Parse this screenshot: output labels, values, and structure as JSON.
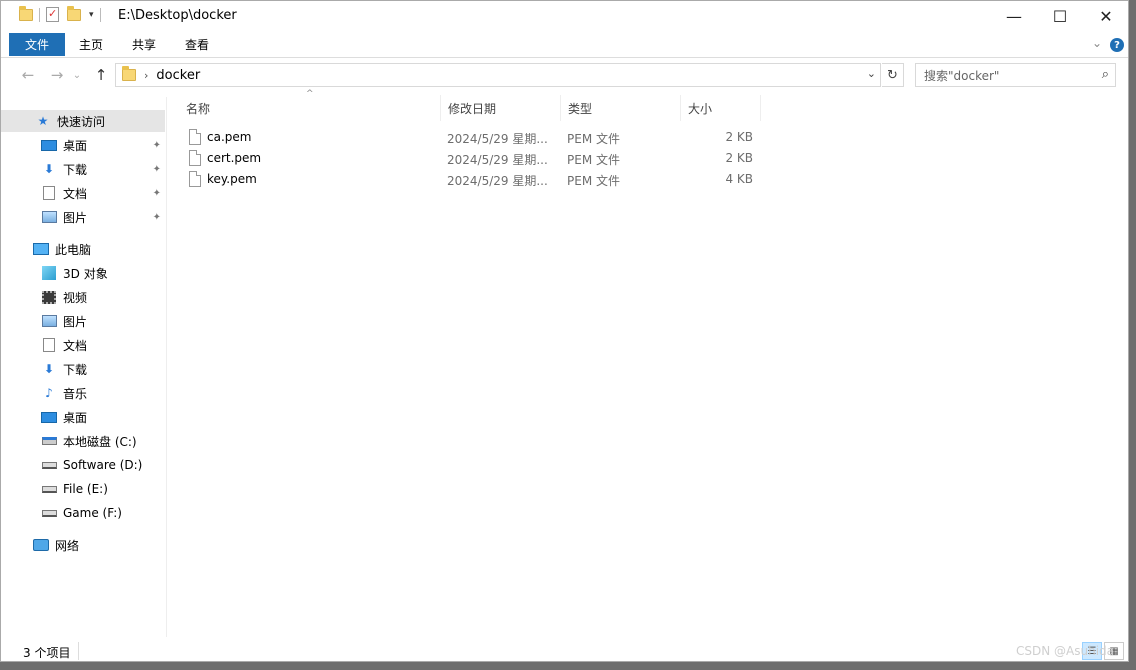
{
  "window": {
    "title": "E:\\Desktop\\docker",
    "minimize": "—",
    "maximize": "☐",
    "close": "✕"
  },
  "ribbon": {
    "tabs": [
      "文件",
      "主页",
      "共享",
      "查看"
    ],
    "help": "?",
    "expand": "⌄"
  },
  "address": {
    "back": "←",
    "forward": "→",
    "recent": "⌄",
    "up": "↑",
    "crumb_sep": "›",
    "path": "docker",
    "dropdown": "⌄",
    "refresh": "↻"
  },
  "search": {
    "placeholder": "搜索\"docker\"",
    "icon": "⌕"
  },
  "sidebar": {
    "items": [
      {
        "label": "快速访问",
        "icon": "star-icon"
      },
      {
        "label": "桌面",
        "icon": "desktop-icon",
        "pinned": true
      },
      {
        "label": "下载",
        "icon": "download-icon",
        "pinned": true
      },
      {
        "label": "文档",
        "icon": "document-icon",
        "pinned": true
      },
      {
        "label": "图片",
        "icon": "picture-icon",
        "pinned": true
      },
      {
        "label": "此电脑",
        "icon": "computer-icon"
      },
      {
        "label": "3D 对象",
        "icon": "3d-objects-icon"
      },
      {
        "label": "视频",
        "icon": "video-icon"
      },
      {
        "label": "图片",
        "icon": "picture-icon"
      },
      {
        "label": "文档",
        "icon": "document-icon"
      },
      {
        "label": "下载",
        "icon": "download-icon"
      },
      {
        "label": "音乐",
        "icon": "music-icon"
      },
      {
        "label": "桌面",
        "icon": "desktop-icon"
      },
      {
        "label": "本地磁盘 (C:)",
        "icon": "system-drive-icon"
      },
      {
        "label": "Software (D:)",
        "icon": "drive-icon"
      },
      {
        "label": "File (E:)",
        "icon": "drive-icon"
      },
      {
        "label": "Game (F:)",
        "icon": "drive-icon"
      },
      {
        "label": "网络",
        "icon": "network-icon"
      }
    ],
    "pin_glyph": "📌"
  },
  "columns": {
    "name": "名称",
    "date": "修改日期",
    "type": "类型",
    "size": "大小",
    "sort_indicator": "^"
  },
  "files": [
    {
      "name": "ca.pem",
      "date": "2024/5/29 星期...",
      "type": "PEM 文件",
      "size": "2 KB"
    },
    {
      "name": "cert.pem",
      "date": "2024/5/29 星期...",
      "type": "PEM 文件",
      "size": "2 KB"
    },
    {
      "name": "key.pem",
      "date": "2024/5/29 星期...",
      "type": "PEM 文件",
      "size": "4 KB"
    }
  ],
  "status": {
    "item_count": "3 个项目",
    "details_view": "☰",
    "tiles_view": "▦"
  },
  "watermark": "CSDN @Asuhida",
  "colors": {
    "accent": "#1f6fb5",
    "selected_bg": "#e5e5e5"
  }
}
